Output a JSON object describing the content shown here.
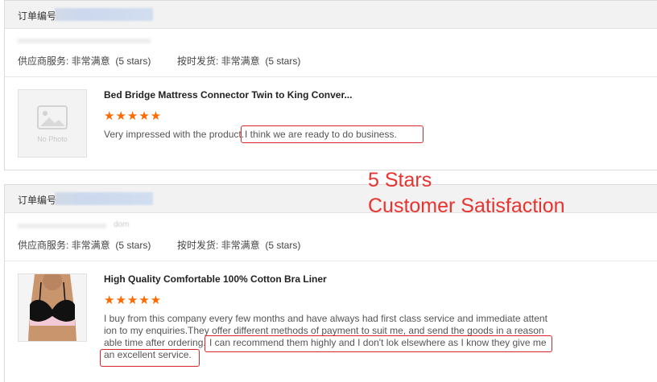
{
  "orders": [
    {
      "order_label": "订单编号",
      "supplier_service_label": "供应商服务: 非常满意",
      "supplier_service_stars": "(5 stars)",
      "shipping_label": "按时发货: 非常满意",
      "shipping_stars": "(5 stars)",
      "product_title": "Bed Bridge Mattress Connector Twin to King Conver...",
      "rating": 5,
      "stars_text": "★★★★★",
      "review_part1": "Very impressed with the product.",
      "review_highlight": "I think we are ready to do business.",
      "thumb_text": "No Photo"
    },
    {
      "order_label": "订单编号",
      "email_fragment": "dom",
      "supplier_service_label": "供应商服务: 非常满意",
      "supplier_service_stars": "(5 stars)",
      "shipping_label": "按时发货: 非常满意",
      "shipping_stars": "(5 stars)",
      "product_title": "High Quality Comfortable 100% Cotton Bra Liner",
      "rating": 5,
      "stars_text": "★★★★★",
      "review_line1": "I buy from this company every few months and have always had first class service and immediate attent",
      "review_line2": "ion to my enquiries.They offer different methods of payment to suit me, and send the goods in a reason",
      "review_line3_plain": "able time after ordering.",
      "review_line3_hl": "I can recommend them highly and I don't lok elsewhere as I know they give me",
      "review_line4_hl": "an excellent service."
    }
  ],
  "overlay": {
    "line1": "5 Stars",
    "line2": "Customer Satisfaction"
  },
  "colors": {
    "star": "#ff6a00",
    "highlight": "#d9262c",
    "overlay_text": "#e8332f"
  }
}
